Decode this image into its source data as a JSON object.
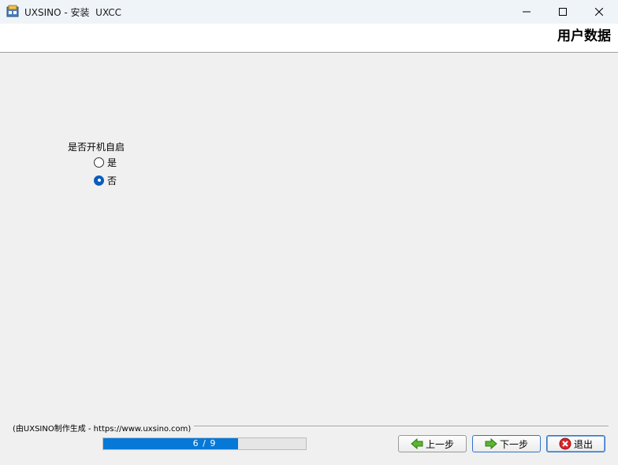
{
  "window": {
    "title": "UXSINO - 安装  UXCC",
    "minimize_icon": "minimize-icon",
    "maximize_icon": "maximize-icon",
    "close_icon": "close-icon"
  },
  "header": {
    "title": "用户数据"
  },
  "form": {
    "question": "是否开机自启",
    "options": [
      {
        "label": "是",
        "checked": false
      },
      {
        "label": "否",
        "checked": true
      }
    ]
  },
  "footer": {
    "credit": "(由UXSINO制作生成 - https://www.uxsino.com)",
    "progress": {
      "text": "6 / 9",
      "current": 6,
      "total": 9
    },
    "buttons": {
      "prev": "上一步",
      "next": "下一步",
      "quit": "退出"
    }
  },
  "colors": {
    "accent": "#0678d7",
    "titlebar": "#eff4f9",
    "background": "#f0f0f0"
  }
}
